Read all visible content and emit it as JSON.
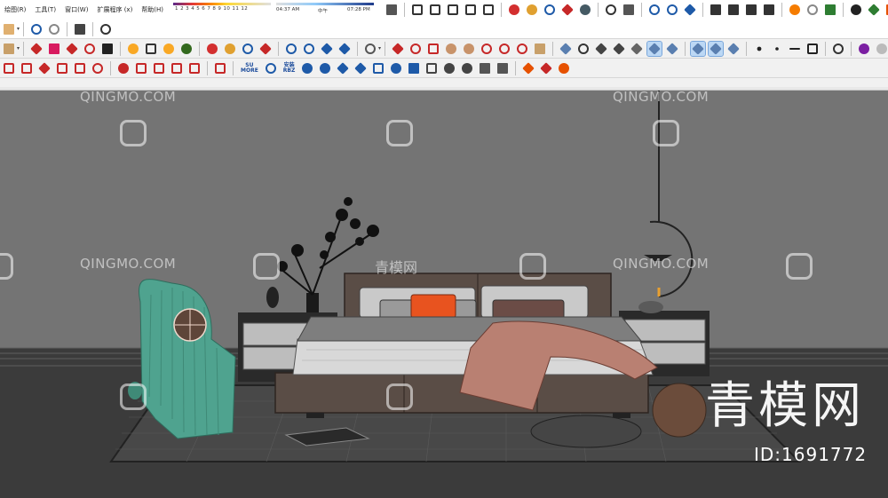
{
  "menubar": {
    "items": [
      "绘图(R)",
      "工具(T)",
      "窗口(W)",
      "扩展程序 (x)",
      "帮助(H)"
    ],
    "month_scale": "1  2  3  4  5  6  7  8  9  10  11  12",
    "sunrise": "04:37 AM",
    "noon": "中午",
    "sunset": "07:28 PM"
  },
  "toolbar": {
    "su_more": "SU\nMORE",
    "rbz": "安装\nRBZ"
  },
  "watermarks": {
    "site_text": "QINGMO.COM",
    "site_cn": "青模网",
    "big_logo": "青模网",
    "id_label": "ID:1691772"
  },
  "colors": {
    "viewport_bg": "#727272",
    "floor": "#3a3a3a",
    "bed_frame": "#5a4d46",
    "pillow_accent": "#e8531f",
    "blanket": "#b98072",
    "chair": "#4fa38f"
  }
}
